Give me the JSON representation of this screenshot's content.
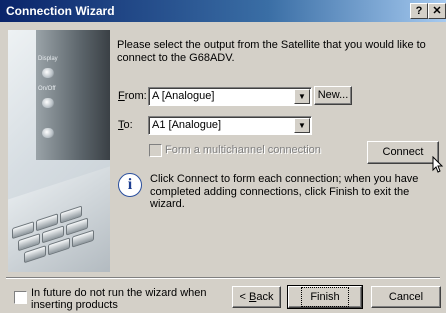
{
  "window": {
    "title": "Connection Wizard",
    "help_button": "?",
    "close_button": "✕"
  },
  "intro": {
    "line1": "Please select the output from the Satellite that you would like to",
    "line2": "connect to the G68ADV."
  },
  "side_image": {
    "label1": "Display",
    "label2": "On/Off"
  },
  "from": {
    "label_accel": "F",
    "label_rest": "rom:",
    "value": "A [Analogue]",
    "new_button": "New..."
  },
  "to": {
    "label_accel": "T",
    "label_rest": "o:",
    "value": "A1 [Analogue]"
  },
  "multichannel": {
    "label": "Form a multichannel connection",
    "checked": false,
    "enabled": false
  },
  "connect_button": "Connect",
  "info": {
    "line1": "Click Connect to form each connection; when you have",
    "line2": "completed adding connections, click Finish to exit the wizard."
  },
  "footer": {
    "checkbox_line1": "In future do not run the wizard when",
    "checkbox_line2": "inserting products",
    "back_accel": "B",
    "back_rest": "ack",
    "back_prefix": "< ",
    "finish": "Finish",
    "cancel": "Cancel"
  },
  "colors": {
    "titlebar_start": "#0a246a",
    "titlebar_end": "#a6caf0",
    "dialog_bg": "#d4d0c8"
  }
}
